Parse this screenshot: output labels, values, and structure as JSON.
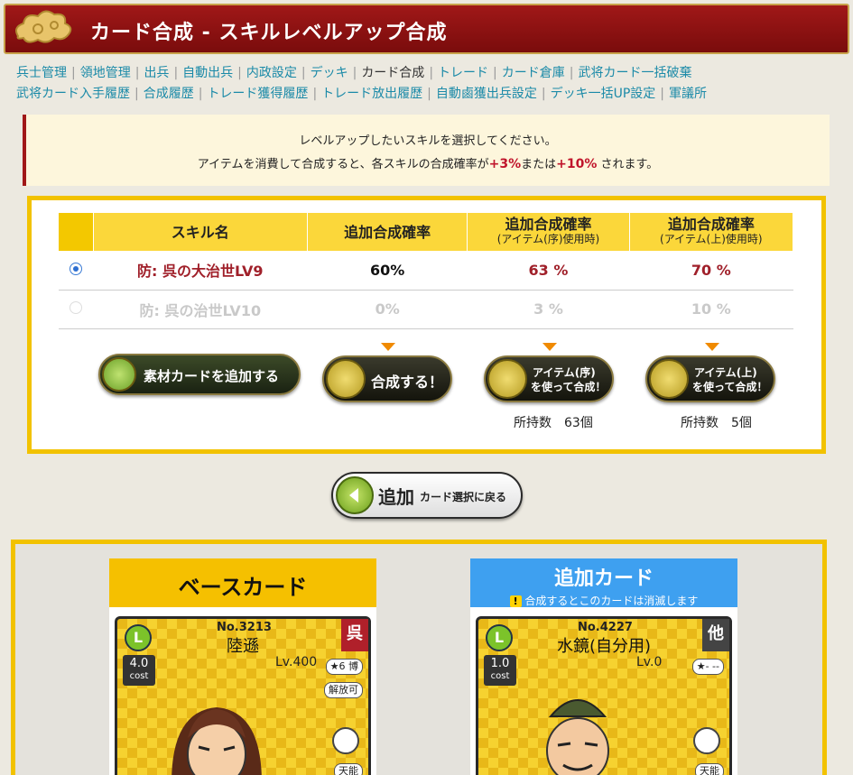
{
  "header": {
    "title": "カード合成 - スキルレベルアップ合成"
  },
  "nav": {
    "row1": [
      "兵士管理",
      "領地管理",
      "出兵",
      "自動出兵",
      "内政設定",
      "デッキ",
      "カード合成",
      "トレード",
      "カード倉庫",
      "武将カード一括破棄"
    ],
    "row2": [
      "武将カード入手履歴",
      "合成履歴",
      "トレード獲得履歴",
      "トレード放出履歴",
      "自動鹵獲出兵設定",
      "デッキ一括UP設定",
      "軍議所"
    ],
    "current": "カード合成"
  },
  "notice": {
    "line1": "レベルアップしたいスキルを選択してください。",
    "line2_pre": "アイテムを消費して合成すると、各スキルの合成確率が",
    "plus3": "+3%",
    "or": "または",
    "plus10": "+10%",
    "line2_post": "されます。"
  },
  "table": {
    "headers": {
      "skill": "スキル名",
      "rate": "追加合成確率",
      "rate_item_mid": "追加合成確率",
      "rate_item_mid_sub": "(アイテム(序)使用時)",
      "rate_item_top": "追加合成確率",
      "rate_item_top_sub": "(アイテム(上)使用時)"
    },
    "rows": [
      {
        "name": "防: 呉の大治世LV9",
        "rate": "60%",
        "mid": "63 %",
        "top": "70 %",
        "selected": true
      },
      {
        "name": "防: 呉の治世LV10",
        "rate": "0%",
        "mid": "3 %",
        "top": "10 %",
        "selected": false
      }
    ]
  },
  "buttons": {
    "add_material": "素材カードを追加する",
    "compose": "合成する！",
    "item_mid": "アイテム(序)を使って合成！",
    "item_mid_l1": "アイテム(序)",
    "item_mid_l2": "を使って合成！",
    "item_top_l1": "アイテム(上)",
    "item_top_l2": "を使って合成！",
    "back_big": "追加",
    "back_small": "カード選択に戻る"
  },
  "owned": {
    "mid": "所持数　63個",
    "top": "所持数　5個"
  },
  "base_card": {
    "heading": "ベースカード",
    "no": "No.3213",
    "name": "陸遜",
    "lv": "Lv.400",
    "cost": "4.0",
    "cost_label": "cost",
    "rarity": "L",
    "faction": "呉",
    "stars": "★6 博",
    "release": "解放可",
    "frag": "天能"
  },
  "add_card": {
    "heading": "追加カード",
    "warning": "合成するとこのカードは消滅します",
    "no": "No.4227",
    "name": "水鏡(自分用)",
    "lv": "Lv.0",
    "cost": "1.0",
    "cost_label": "cost",
    "rarity": "L",
    "faction": "他",
    "stars": "★- --",
    "frag": "天能"
  },
  "colors": {
    "header_bg": "#8a1010",
    "accent_gold": "#f2c200",
    "link": "#1b8aa8",
    "red_text": "#c0152b"
  }
}
